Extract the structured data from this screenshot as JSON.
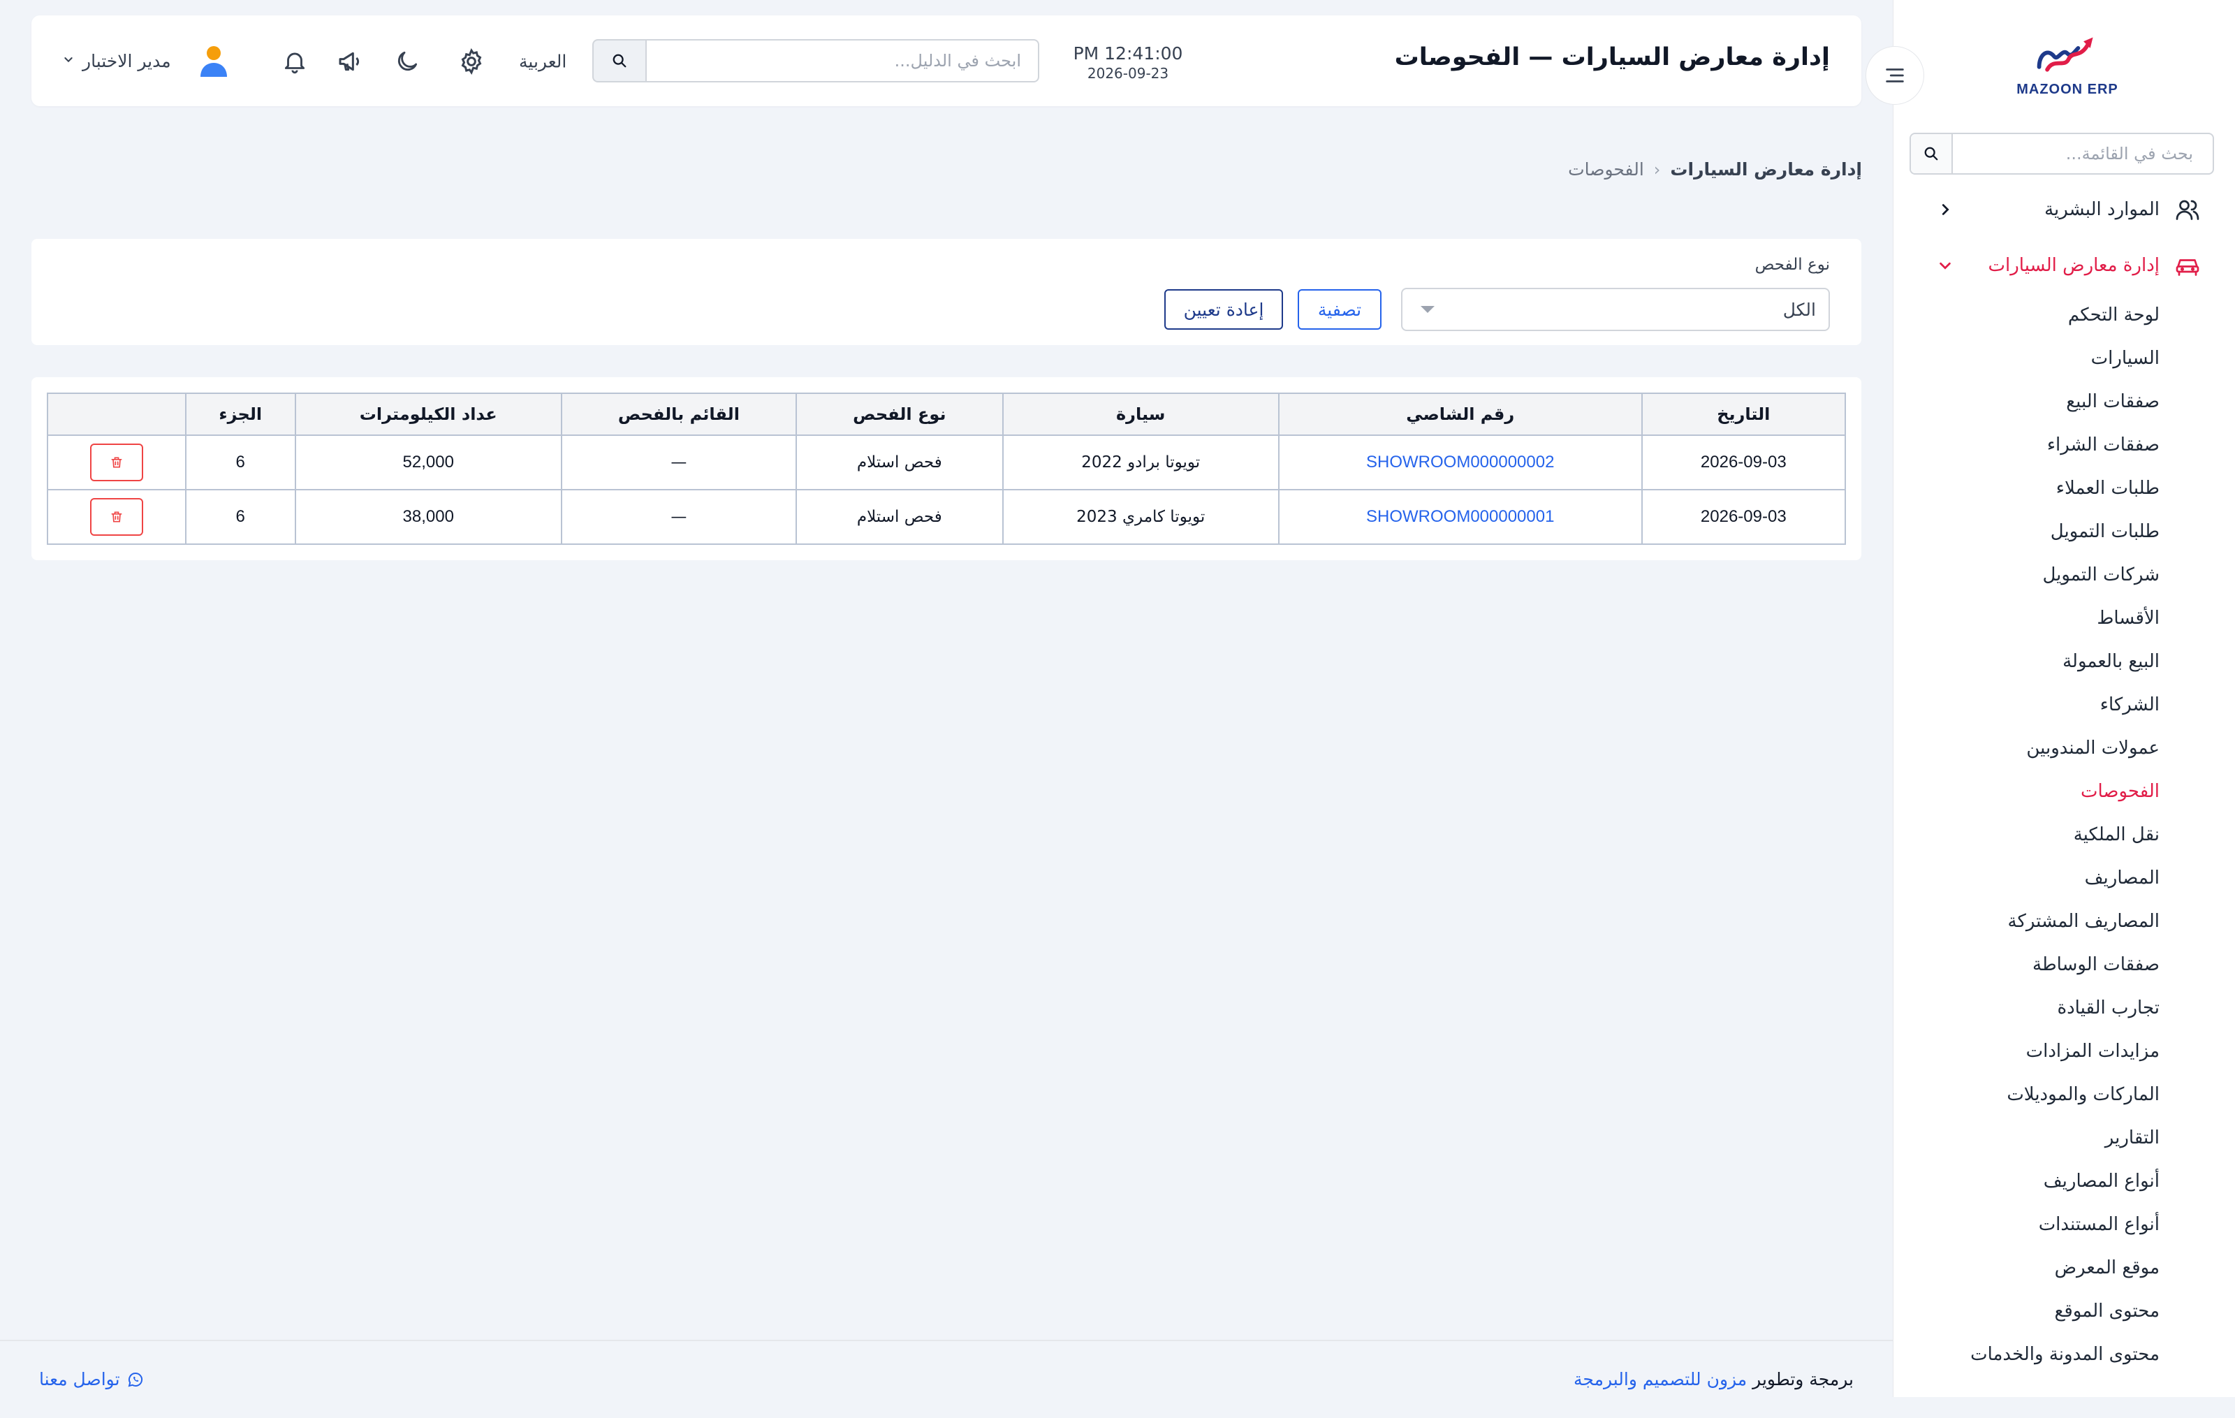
{
  "sidebar": {
    "logo_text": "MAZOON ERP",
    "search_placeholder": "بحث في القائمة...",
    "groups": [
      {
        "label": "الموارد البشرية",
        "icon": "users-icon",
        "expanded": false
      },
      {
        "label": "إدارة معارض السيارات",
        "icon": "car-icon",
        "expanded": true
      }
    ],
    "items": [
      {
        "label": "لوحة التحكم"
      },
      {
        "label": "السيارات"
      },
      {
        "label": "صفقات البيع"
      },
      {
        "label": "صفقات الشراء"
      },
      {
        "label": "طلبات العملاء"
      },
      {
        "label": "طلبات التمويل"
      },
      {
        "label": "شركات التمويل"
      },
      {
        "label": "الأقساط"
      },
      {
        "label": "البيع بالعمولة"
      },
      {
        "label": "الشركاء"
      },
      {
        "label": "عمولات المندوبين"
      },
      {
        "label": "الفحوصات",
        "active": true
      },
      {
        "label": "نقل الملكية"
      },
      {
        "label": "المصاريف"
      },
      {
        "label": "المصاريف المشتركة"
      },
      {
        "label": "صفقات الوساطة"
      },
      {
        "label": "تجارب القيادة"
      },
      {
        "label": "مزايدات المزادات"
      },
      {
        "label": "الماركات والموديلات"
      },
      {
        "label": "التقارير"
      },
      {
        "label": "أنواع المصاريف"
      },
      {
        "label": "أنواع المستندات"
      },
      {
        "label": "موقع المعرض"
      },
      {
        "label": "محتوى الموقع"
      },
      {
        "label": "محتوى المدونة والخدمات"
      }
    ]
  },
  "header": {
    "title": "إدارة معارض السيارات — الفحوصات",
    "time": "PM 12:41:00",
    "date": "2026-09-23",
    "search_placeholder": "ابحث في الدليل...",
    "language": "العربية",
    "user_name": "مدير الاختبار"
  },
  "breadcrumb": {
    "parent": "إدارة معارض السيارات",
    "current": "الفحوصات"
  },
  "filter": {
    "label": "نوع الفحص",
    "selected": "الكل",
    "filter_button": "تصفية",
    "reset_button": "إعادة تعيين"
  },
  "table": {
    "columns": [
      "التاريخ",
      "رقم الشاصي",
      "سيارة",
      "نوع الفحص",
      "القائم بالفحص",
      "عداد الكيلومترات",
      "الجزء",
      ""
    ],
    "rows": [
      {
        "date": "2026-09-03",
        "chassis": "SHOWROOM000000002",
        "car": "تويوتا برادو 2022",
        "type": "فحص استلام",
        "inspector": "—",
        "odometer": "52,000",
        "part": "6"
      },
      {
        "date": "2026-09-03",
        "chassis": "SHOWROOM000000001",
        "car": "تويوتا كامري 2023",
        "type": "فحص استلام",
        "inspector": "—",
        "odometer": "38,000",
        "part": "6"
      }
    ]
  },
  "footer": {
    "credit_prefix": "برمجة وتطوير",
    "credit_company": "مزون للتصميم والبرمجة",
    "contact": "تواصل معنا"
  },
  "colors": {
    "accent": "#e11d48",
    "primary": "#2563eb",
    "navy": "#1e3a8a",
    "background": "#f1f4f9"
  }
}
